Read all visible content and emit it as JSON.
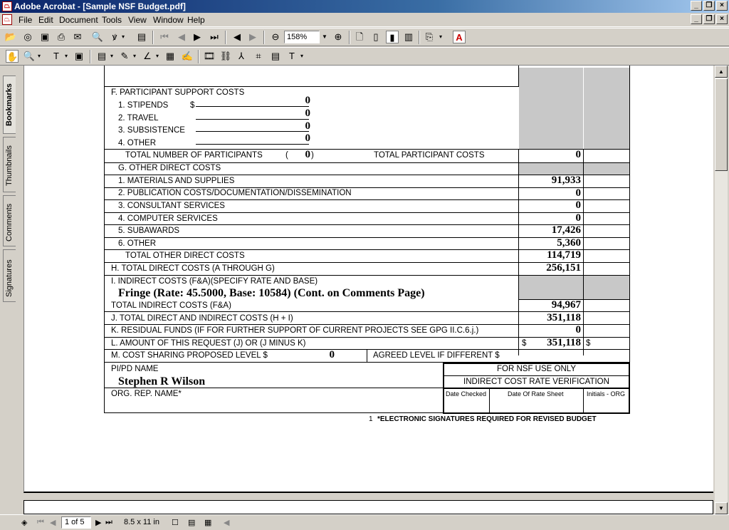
{
  "window": {
    "title": "Adobe Acrobat - [Sample NSF Budget.pdf]"
  },
  "menu": [
    "File",
    "Edit",
    "Document",
    "Tools",
    "View",
    "Window",
    "Help"
  ],
  "toolbar": {
    "zoom": "158%"
  },
  "sidetabs": [
    "Bookmarks",
    "Thumbnails",
    "Comments",
    "Signatures"
  ],
  "status": {
    "page": "1 of 5",
    "page_size": "8.5 x 11 in"
  },
  "form": {
    "F": "F.  PARTICIPANT SUPPORT COSTS",
    "F1": "1. STIPENDS",
    "F1_cur": "$",
    "F1_v": "0",
    "F2": "2. TRAVEL",
    "F2_v": "0",
    "F3": "3. SUBSISTENCE",
    "F3_v": "0",
    "F4": "4. OTHER",
    "F4_v": "0",
    "Fnum": "TOTAL NUMBER OF PARTICIPANTS",
    "Fnum_open": "(",
    "Fnum_v": "0",
    "Fnum_close": ")",
    "Ftot": "TOTAL PARTICIPANT COSTS",
    "Ftot_v": "0",
    "G": "G.  OTHER DIRECT COSTS",
    "G1": "1. MATERIALS AND SUPPLIES",
    "G1_v": "91,933",
    "G2": "2. PUBLICATION COSTS/DOCUMENTATION/DISSEMINATION",
    "G2_v": "0",
    "G3": "3. CONSULTANT SERVICES",
    "G3_v": "0",
    "G4": "4. COMPUTER SERVICES",
    "G4_v": "0",
    "G5": "5. SUBAWARDS",
    "G5_v": "17,426",
    "G6": "6. OTHER",
    "G6_v": "5,360",
    "Gtot": "TOTAL OTHER DIRECT COSTS",
    "Gtot_v": "114,719",
    "H": "H.  TOTAL DIRECT COSTS (A THROUGH G)",
    "H_v": "256,151",
    "I": "I.  INDIRECT COSTS (F&A)(SPECIFY RATE AND BASE)",
    "I_rate": "Fringe (Rate: 45.5000, Base: 10584) (Cont. on Comments Page)",
    "Itot": "TOTAL INDIRECT COSTS (F&A)",
    "Itot_v": "94,967",
    "J": "J.  TOTAL DIRECT AND INDIRECT COSTS (H + I)",
    "J_v": "351,118",
    "K": "K.  RESIDUAL FUNDS (IF FOR FURTHER SUPPORT OF CURRENT  PROJECTS SEE GPG II.C.6.j.)",
    "K_v": "0",
    "L": "L.  AMOUNT OF THIS REQUEST (J) OR (J MINUS K)",
    "L_cur": "$",
    "L_v": "351,118",
    "L_cur2": "$",
    "M": "M. COST SHARING PROPOSED LEVEL $",
    "M_v": "0",
    "M_agreed": "AGREED LEVEL IF DIFFERENT $",
    "pi_label": "PI/PD NAME",
    "pi_name": "Stephen R Wilson",
    "org_label": "ORG. REP. NAME*",
    "nsf_only": "FOR NSF USE ONLY",
    "nsf_verif": "INDIRECT COST RATE VERIFICATION",
    "nsf_c1": "Date Checked",
    "nsf_c2": "Date Of Rate Sheet",
    "nsf_c3": "Initials - ORG",
    "footer_num": "1",
    "footer": "*ELECTRONIC SIGNATURES REQUIRED FOR REVISED BUDGET"
  }
}
